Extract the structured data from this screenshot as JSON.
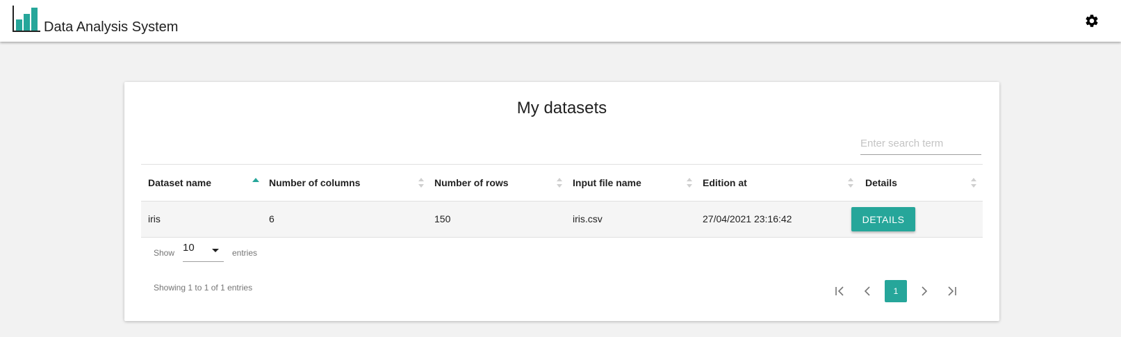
{
  "app": {
    "title": "Data Analysis System",
    "accent_color": "#26a69a"
  },
  "header": {
    "logo_icon": "bar-chart-icon",
    "settings_icon": "gear-icon"
  },
  "card": {
    "title": "My datasets",
    "search": {
      "placeholder": "Enter search term",
      "value": ""
    }
  },
  "table": {
    "columns": [
      {
        "label": "Dataset name",
        "sort": "ascending"
      },
      {
        "label": "Number of columns",
        "sort": "none"
      },
      {
        "label": "Number of rows",
        "sort": "none"
      },
      {
        "label": "Input file name",
        "sort": "none"
      },
      {
        "label": "Edition at",
        "sort": "none"
      },
      {
        "label": "Details",
        "sort": "none"
      }
    ],
    "rows": [
      {
        "dataset_name": "iris",
        "num_columns": "6",
        "num_rows": "150",
        "input_file": "iris.csv",
        "edition_at": "27/04/2021 23:16:42",
        "details_label": "DETAILS"
      }
    ]
  },
  "footer": {
    "show_label": "Show",
    "page_length": "10",
    "entries_label": "entries",
    "info": "Showing 1 to 1 of 1 entries",
    "current_page": "1",
    "pager_icons": [
      "first-page-icon",
      "previous-page-icon",
      "next-page-icon",
      "last-page-icon"
    ]
  }
}
